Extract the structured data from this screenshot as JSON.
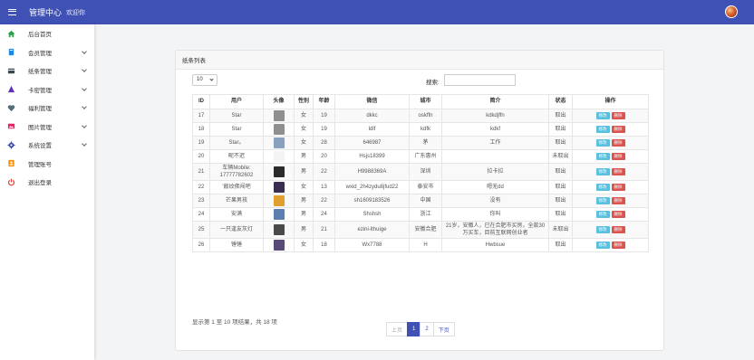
{
  "header": {
    "title": "管理中心",
    "welcome": "欢迎你",
    "menu_icon": "menu-icon",
    "avatar_icon": "user-avatar"
  },
  "sidebar": {
    "items": [
      {
        "label": "后台首页",
        "icon": "home-icon",
        "color": "#2e9e4f",
        "submenu": false
      },
      {
        "label": "会员管理",
        "icon": "book-icon",
        "color": "#1e88e5",
        "submenu": true
      },
      {
        "label": "纸条管理",
        "icon": "card-icon",
        "color": "#37474f",
        "submenu": true
      },
      {
        "label": "卡密管理",
        "icon": "triangle-icon",
        "color": "#5e35b1",
        "submenu": true
      },
      {
        "label": "福利管理",
        "icon": "heart-icon",
        "color": "#546e7a",
        "submenu": true
      },
      {
        "label": "图片管理",
        "icon": "image-icon",
        "color": "#e91e63",
        "submenu": true
      },
      {
        "label": "系统设置",
        "icon": "gear-icon",
        "color": "#3949ab",
        "submenu": true
      },
      {
        "label": "管理账号",
        "icon": "account-icon",
        "color": "#fb8c00",
        "submenu": false
      },
      {
        "label": "退出登录",
        "icon": "power-icon",
        "color": "#e53935",
        "submenu": false
      }
    ]
  },
  "panel": {
    "title": "纸条列表",
    "page_size": "10",
    "search_label": "搜索:",
    "search_value": "",
    "columns": [
      "ID",
      "用户",
      "头像",
      "性别",
      "年龄",
      "微信",
      "城市",
      "简介",
      "状态",
      "操作"
    ],
    "edit_label": "修改",
    "delete_label": "删除",
    "rows": [
      {
        "id": "17",
        "user": "Star",
        "thumb": "#8f8f8f",
        "sex": "女",
        "age": "19",
        "wechat": "dkkc",
        "city": "oskffn",
        "intro": "kdkdjffn",
        "status": "取出"
      },
      {
        "id": "18",
        "user": "Star",
        "thumb": "#8f8f8f",
        "sex": "女",
        "age": "19",
        "wechat": "ldlf",
        "city": "kdfk",
        "intro": "kdkf",
        "status": "取出"
      },
      {
        "id": "19",
        "user": "Star。",
        "thumb": "#8aa0bf",
        "sex": "女",
        "age": "28",
        "wechat": "646987",
        "city": "茅",
        "intro": "工作",
        "status": "取出"
      },
      {
        "id": "20",
        "user": "昵不迟",
        "thumb": "#f4f4f4",
        "sex": "男",
        "age": "20",
        "wechat": "Hsjs18399",
        "city": "广东惠州",
        "intro": "",
        "status": "未取出"
      },
      {
        "id": "21",
        "user": "车辆Mobile: 17777782602",
        "thumb": "#2b2b2b",
        "sex": "男",
        "age": "22",
        "wechat": "H9988369A",
        "city": "深圳",
        "intro": "拉卡拉",
        "status": "取出"
      },
      {
        "id": "22",
        "user": "'敲纹佛闯吧",
        "thumb": "#3b2d52",
        "sex": "女",
        "age": "13",
        "wechat": "wxid_2h4zydu8jfud22",
        "city": "泰安市",
        "intro": "嗯无dd",
        "status": "取出"
      },
      {
        "id": "23",
        "user": "芒果男孩",
        "thumb": "#e0a030",
        "sex": "男",
        "age": "22",
        "wechat": "sh1609183526",
        "city": "中国",
        "intro": "没有",
        "status": "取出"
      },
      {
        "id": "24",
        "user": "安满",
        "thumb": "#5c7fb0",
        "sex": "男",
        "age": "24",
        "wechat": "Shshsh",
        "city": "浙江",
        "intro": "你叫",
        "status": "取出"
      },
      {
        "id": "25",
        "user": "一只逢友灰灯",
        "thumb": "#4a4a4a",
        "sex": "男",
        "age": "21",
        "wechat": "ezini-lthuige",
        "city": "安徽合肥",
        "intro": "21岁，安徽人，已在合肥市买房，全款30万买车，目前互联网创业者",
        "status": "未取出"
      },
      {
        "id": "26",
        "user": "锤锤",
        "thumb": "#5a4a7a",
        "sex": "女",
        "age": "18",
        "wechat": "Wx7788",
        "city": "H",
        "intro": "Hwbsue",
        "status": "取出"
      }
    ],
    "info": "显示第 1 至 10 项结果，共 18 项",
    "pager": {
      "prev": "上页",
      "pages": [
        "1",
        "2"
      ],
      "current": "1",
      "next": "下页"
    }
  }
}
